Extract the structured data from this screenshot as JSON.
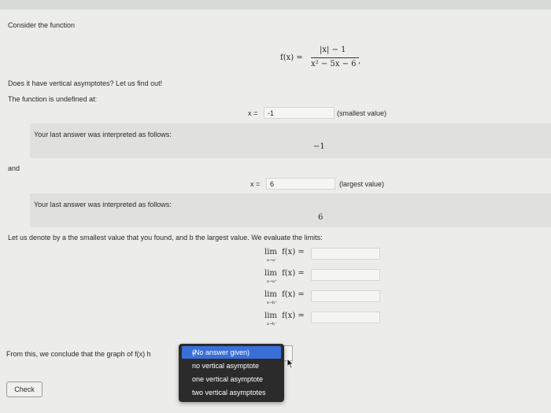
{
  "intro": "Consider the function",
  "function": {
    "lhs": "f(x) =",
    "numerator": "|x| − 1",
    "denominator": "x² − 5x − 6",
    "trailing": ","
  },
  "question": "Does it have vertical asymptotes? Let us find out!",
  "undefined_at": "The function is undefined at:",
  "answer1": {
    "label": "x =",
    "value": "-1",
    "hint": "(smallest value)",
    "interpreted_label": "Your last answer was interpreted as follows:",
    "interpreted_value": "−1"
  },
  "and": "and",
  "answer2": {
    "label": "x =",
    "value": "6",
    "hint": "(largest value)",
    "interpreted_label": "Your last answer was interpreted as follows:",
    "interpreted_value": "6"
  },
  "denote": "Let us denote by a the smallest value that you found, and b the largest value. We evaluate the limits:",
  "limits": [
    {
      "lim": "lim",
      "fx": "f(x) =",
      "sub": "x→a⁻",
      "value": ""
    },
    {
      "lim": "lim",
      "fx": "f(x) =",
      "sub": "x→a⁺",
      "value": ""
    },
    {
      "lim": "lim",
      "fx": "f(x) =",
      "sub": "x→b⁺",
      "value": ""
    },
    {
      "lim": "lim",
      "fx": "f(x) =",
      "sub": "x→b⁻",
      "value": ""
    }
  ],
  "conclude": "From this, we conclude that the graph of f(x) h",
  "dropdown": {
    "options": [
      "(No answer given)",
      "no vertical asymptote",
      "one vertical asymptote",
      "two vertical asymptotes"
    ],
    "selected": "(No answer given)"
  },
  "check_button": "Check"
}
